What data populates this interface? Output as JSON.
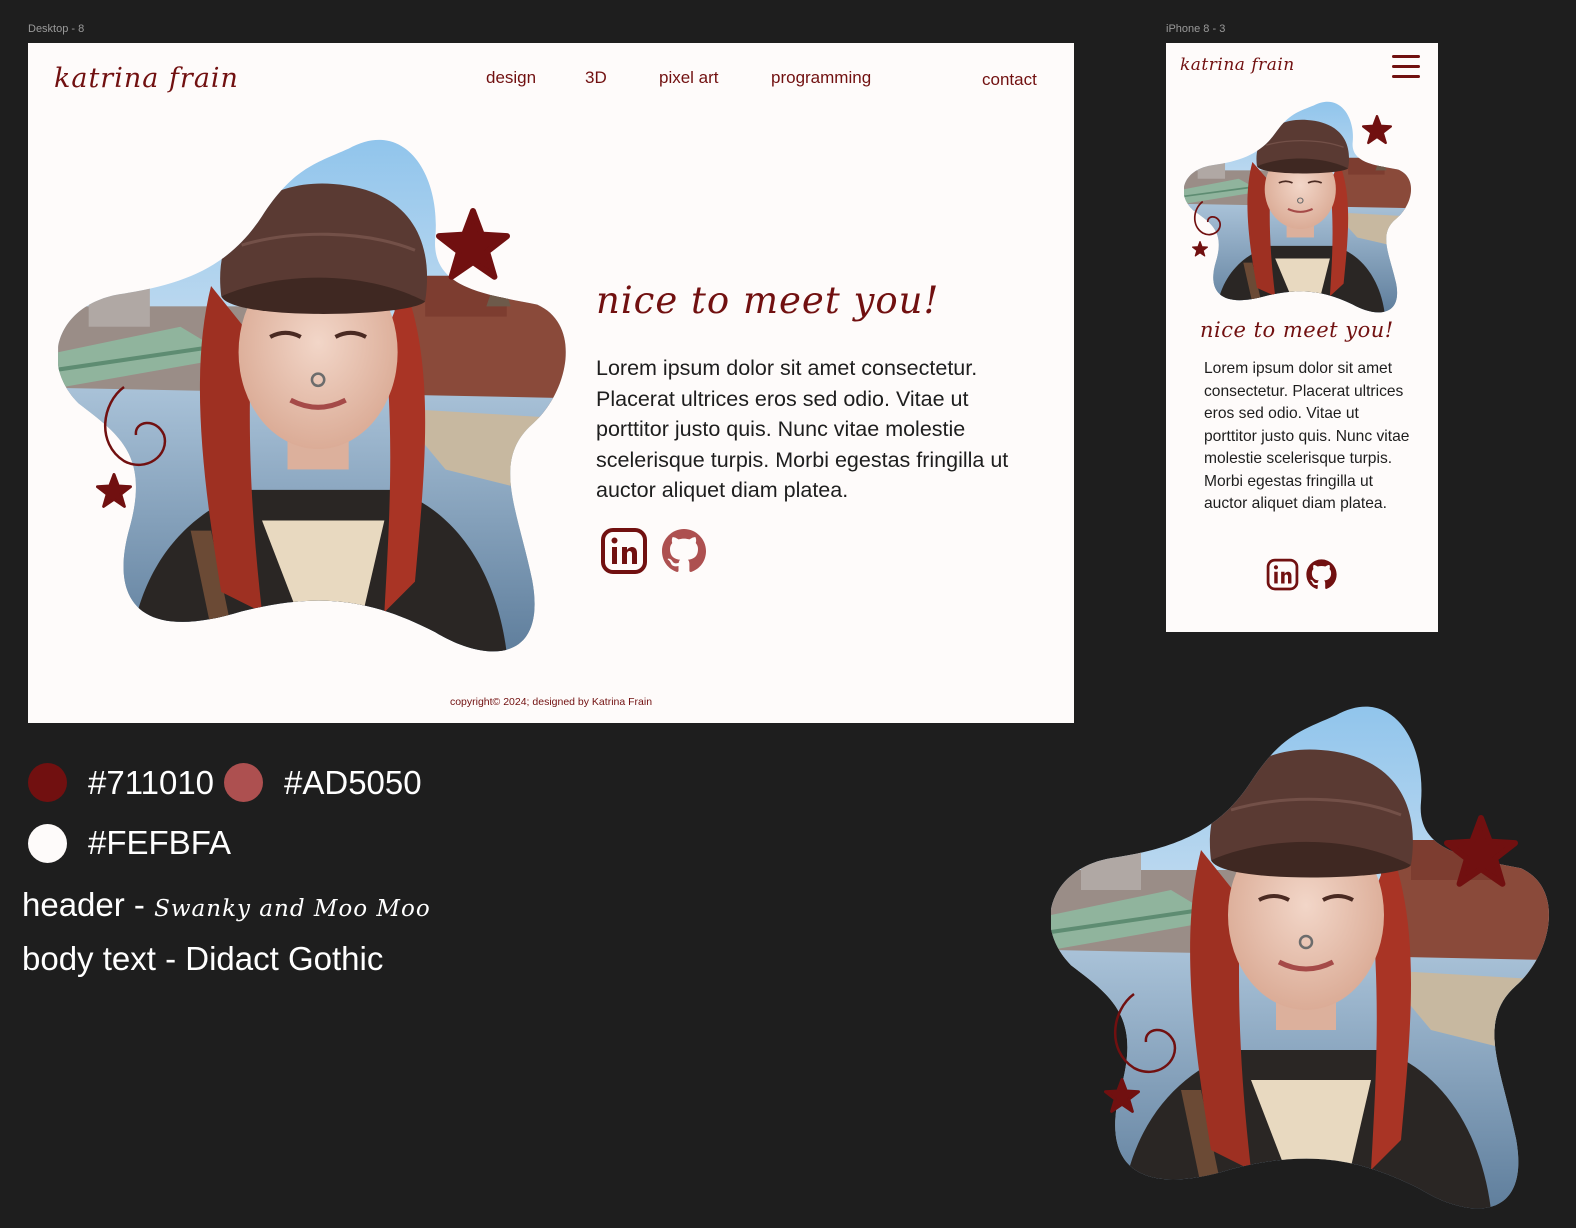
{
  "frames": {
    "desktop_label": "Desktop - 8",
    "phone_label": "iPhone 8 - 3"
  },
  "desktop": {
    "logo": "katrina frain",
    "nav": [
      "design",
      "3D",
      "pixel art",
      "programming"
    ],
    "contact": "contact",
    "title": "nice to meet you!",
    "body": "Lorem ipsum dolor sit amet consectetur. Placerat ultrices eros sed odio. Vitae ut porttitor justo quis.  Nunc vitae molestie scelerisque turpis.  Morbi egestas fringilla ut auctor aliquet diam platea.",
    "footer": "copyright©  2024; designed by Katrina Frain",
    "social": [
      "linkedin-icon",
      "github-icon"
    ]
  },
  "phone": {
    "logo": "katrina frain",
    "title": "nice to meet you!",
    "body": "Lorem ipsum dolor sit amet consectetur.  Placerat ultrices eros sed odio. Vitae ut porttitor justo quis.  Nunc vitae molestie scelerisque turpis.  Morbi egestas fringilla ut auctor aliquet diam platea.",
    "menu_icon": "hamburger-menu-icon"
  },
  "style_guide": {
    "colors": [
      {
        "hex": "#711010",
        "label": "#711010"
      },
      {
        "hex": "#AD5050",
        "label": "#AD5050"
      },
      {
        "hex": "#FEFBFA",
        "label": "#FEFBFA"
      }
    ],
    "header_font_label": "header - ",
    "header_font_name": "Swanky and Moo Moo",
    "body_font_label": "body text -  ",
    "body_font_name": "Didact Gothic"
  }
}
